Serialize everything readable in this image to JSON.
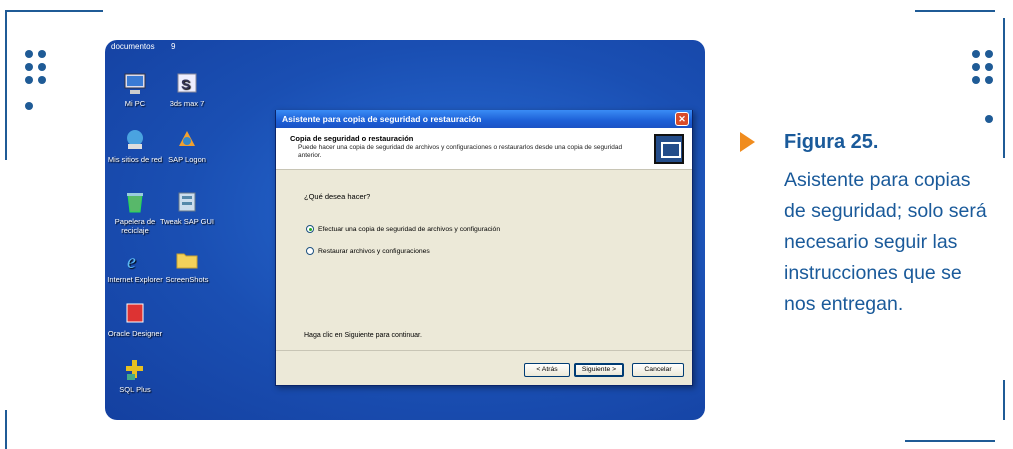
{
  "desktop": {
    "top_label": "documentos",
    "top_count": "9",
    "icons": [
      {
        "label": "Mi PC"
      },
      {
        "label": "3ds max 7"
      },
      {
        "label": "Mis sitios de red"
      },
      {
        "label": "SAP Logon"
      },
      {
        "label": "Papelera de reciclaje"
      },
      {
        "label": "Tweak SAP GUI"
      },
      {
        "label": "Internet Explorer"
      },
      {
        "label": "ScreenShots"
      },
      {
        "label": "Oracle Designer"
      },
      {
        "label": "SQL Plus"
      }
    ]
  },
  "dialog": {
    "title": "Asistente para copia de seguridad o restauración",
    "close_label": "✕",
    "header_title": "Copia de seguridad o restauración",
    "header_desc": "Puede hacer una copia de seguridad de archivos y configuraciones o restaurarlos desde una copia de seguridad anterior.",
    "question": "¿Qué desea hacer?",
    "options": [
      {
        "label": "Efectuar una copia de seguridad de archivos y configuración",
        "selected": true
      },
      {
        "label": "Restaurar archivos y configuraciones",
        "selected": false
      }
    ],
    "hint": "Haga clic en Siguiente para continuar.",
    "buttons": {
      "back": "< Atrás",
      "next": "Siguiente >",
      "cancel": "Cancelar"
    }
  },
  "caption": {
    "title": "Figura 25.",
    "body": "Asistente para copias de seguridad; solo será necesario seguir las instrucciones que se nos entregan."
  },
  "colors": {
    "accent": "#1f5b96",
    "arrow": "#f08c1e",
    "desktop": "#1a4fb3"
  }
}
